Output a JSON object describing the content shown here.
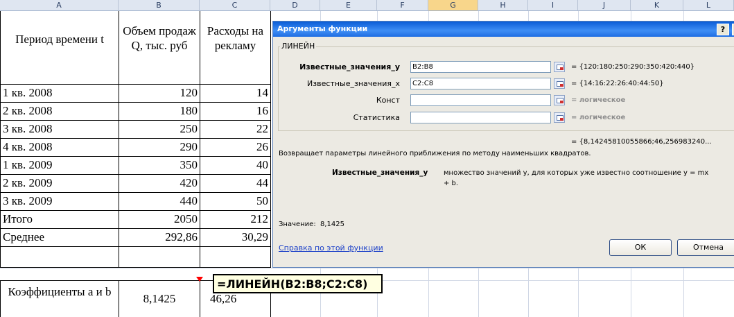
{
  "columns": [
    "A",
    "B",
    "C",
    "D",
    "E",
    "F",
    "G",
    "H",
    "I",
    "J",
    "K",
    "L"
  ],
  "table": {
    "header": {
      "a": "Период времени t",
      "b": "Объем продаж Q, тыс. руб",
      "c": "Расходы на рекламу"
    },
    "rows": [
      {
        "a": "1 кв. 2008",
        "b": "120",
        "c": "14"
      },
      {
        "a": "2 кв. 2008",
        "b": "180",
        "c": "16"
      },
      {
        "a": "3 кв. 2008",
        "b": "250",
        "c": "22"
      },
      {
        "a": "4 кв. 2008",
        "b": "290",
        "c": "26"
      },
      {
        "a": "1 кв. 2009",
        "b": "350",
        "c": "40"
      },
      {
        "a": "2 кв. 2009",
        "b": "420",
        "c": "44"
      },
      {
        "a": "3 кв. 2009",
        "b": "440",
        "c": "50"
      },
      {
        "a": "Итого",
        "b": "2050",
        "c": "212"
      },
      {
        "a": "Среднее",
        "b": "292,86",
        "c": "30,29"
      }
    ],
    "coef": {
      "a": "Коэффициенты a и b",
      "b": "8,1425",
      "c": "46,26"
    }
  },
  "tooltip": "=ЛИНЕЙН(B2:B8;C2:C8)",
  "dialog": {
    "title": "Аргументы функции",
    "help": "?",
    "close": "X",
    "function_name": "ЛИНЕЙН",
    "args": [
      {
        "label": "Известные_значения_y",
        "value": "B2:B8",
        "result": "= {120:180:250:290:350:420:440}"
      },
      {
        "label": "Известные_значения_x",
        "value": "C2:C8",
        "result": "= {14:16:22:26:40:44:50}"
      },
      {
        "label": "Конст",
        "value": "",
        "result": "= логическое"
      },
      {
        "label": "Статистика",
        "value": "",
        "result": "= логическое"
      }
    ],
    "overall_result": "= {8,14245810055866;46,256983240...",
    "description": "Возвращает параметры линейного приближения по методу наименьших квадратов.",
    "arg_help_name": "Известные_значения_y",
    "arg_help_text_1": "множество значений y, для которых уже известно соотношение y = mx",
    "arg_help_text_2": "+ b.",
    "value_label": "Значение:",
    "value": "8,1425",
    "help_link": "Справка по этой функции",
    "ok": "ОК",
    "cancel": "Отмена"
  }
}
